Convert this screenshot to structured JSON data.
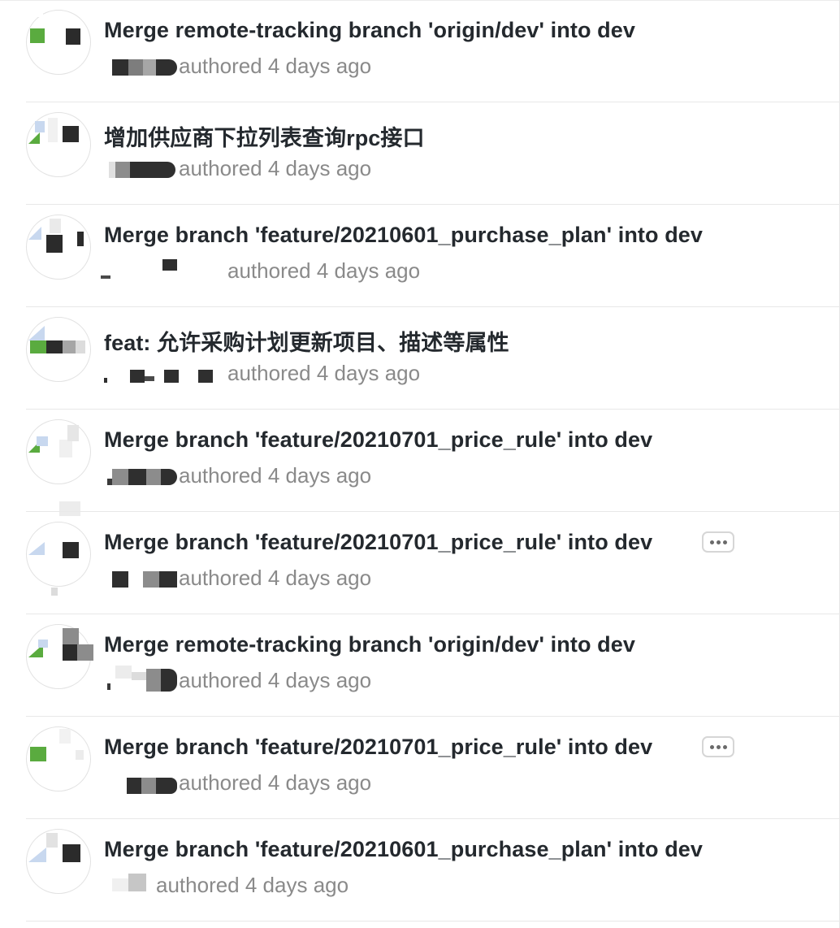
{
  "commits": [
    {
      "message": "Merge remote-tracking branch 'origin/dev' into dev",
      "authored": "authored 4 days ago",
      "has_more": false
    },
    {
      "message": "增加供应商下拉列表查询rpc接口",
      "authored": "authored 4 days ago",
      "has_more": false
    },
    {
      "message": "Merge branch 'feature/20210601_purchase_plan' into dev",
      "authored": "authored 4 days ago",
      "has_more": false
    },
    {
      "message": "feat: 允许采购计划更新项目、描述等属性",
      "authored": "authored 4 days ago",
      "has_more": false
    },
    {
      "message": "Merge branch 'feature/20210701_price_rule' into dev",
      "authored": "authored 4 days ago",
      "has_more": false
    },
    {
      "message": "Merge branch 'feature/20210701_price_rule' into dev",
      "authored": "authored 4 days ago",
      "has_more": true
    },
    {
      "message": "Merge remote-tracking branch 'origin/dev' into dev",
      "authored": "authored 4 days ago",
      "has_more": false
    },
    {
      "message": "Merge branch 'feature/20210701_price_rule' into dev",
      "authored": "authored 4 days ago",
      "has_more": true
    },
    {
      "message": "Merge branch 'feature/20210601_purchase_plan' into dev",
      "authored": "authored 4 days ago",
      "has_more": false
    }
  ],
  "icons": {
    "more": "ellipsis-icon"
  },
  "colors": {
    "title": "#24292e",
    "meta": "#8a8a8a",
    "separator": "#e8e8e8"
  }
}
